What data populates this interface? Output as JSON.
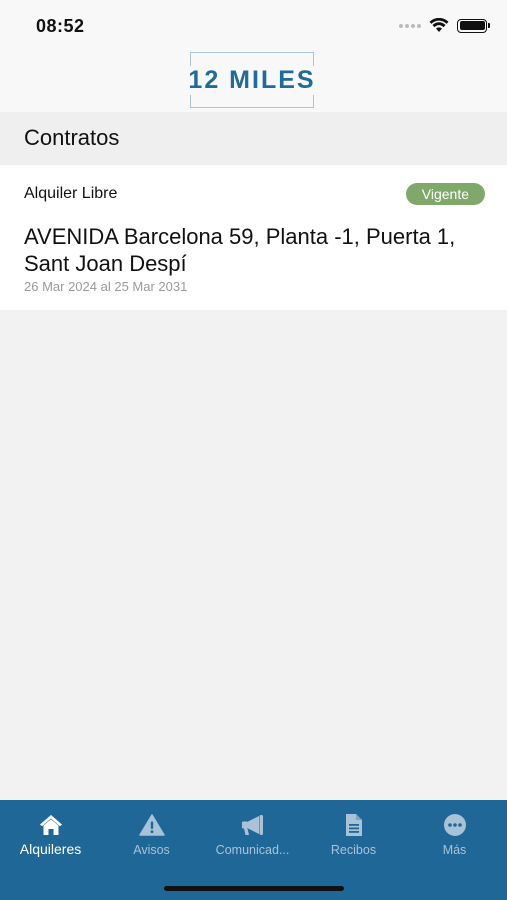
{
  "status_bar": {
    "time": "08:52"
  },
  "header": {
    "logo_text": "12 MILES"
  },
  "section": {
    "title": "Contratos"
  },
  "contracts": [
    {
      "type": "Alquiler Libre",
      "status": "Vigente",
      "address": "AVENIDA Barcelona 59, Planta -1, Puerta 1, Sant Joan Despí",
      "period": "26 Mar 2024 al 25 Mar 2031"
    }
  ],
  "bottom_nav": {
    "items": [
      {
        "label": "Alquileres",
        "icon": "home-icon",
        "active": true
      },
      {
        "label": "Avisos",
        "icon": "warning-icon",
        "active": false
      },
      {
        "label": "Comunicad...",
        "icon": "megaphone-icon",
        "active": false
      },
      {
        "label": "Recibos",
        "icon": "document-icon",
        "active": false
      },
      {
        "label": "Más",
        "icon": "more-icon",
        "active": false
      }
    ]
  },
  "colors": {
    "brand": "#1f6797",
    "badge": "#7fa86a",
    "nav_inactive": "#a9c2d6"
  }
}
